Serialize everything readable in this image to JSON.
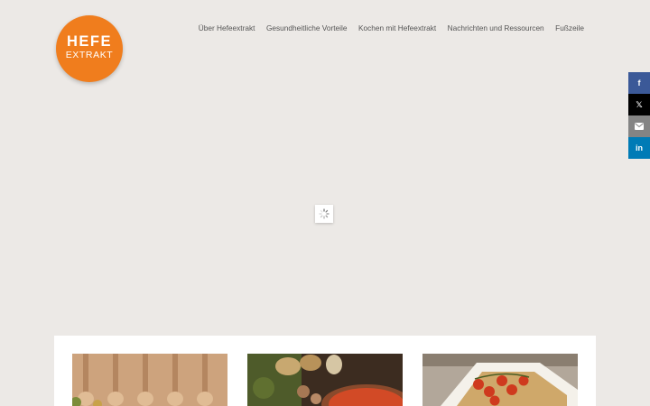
{
  "logo": {
    "line1": "HEFE",
    "line2": "EXTRAKT"
  },
  "nav": {
    "items": [
      {
        "label": "Über Hefeextrakt"
      },
      {
        "label": "Gesundheitliche Vorteile"
      },
      {
        "label": "Kochen mit Hefeextrakt"
      },
      {
        "label": "Nachrichten und Ressourcen"
      },
      {
        "label": "Fußzeile"
      }
    ]
  },
  "share": {
    "facebook": {
      "icon": "facebook-icon",
      "glyph": "f",
      "color": "#3b5998"
    },
    "x": {
      "icon": "x-icon",
      "glyph": "𝕏",
      "color": "#000000"
    },
    "email": {
      "icon": "envelope-icon",
      "color": "#848484"
    },
    "linkedin": {
      "icon": "linkedin-icon",
      "glyph": "in",
      "color": "#007bb6"
    }
  },
  "colors": {
    "brand": "#f07d1d",
    "background": "#ece9e6"
  }
}
